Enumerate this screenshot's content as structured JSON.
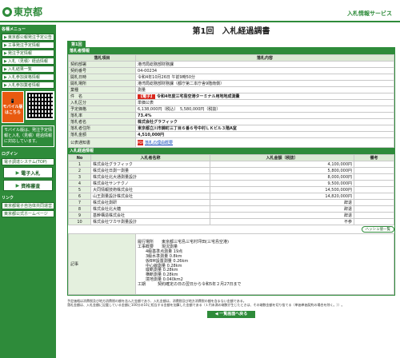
{
  "header": {
    "logo_text": "東京都",
    "service_title": "入札情報サービス"
  },
  "sidebar": {
    "menu_heading": "各種メニュー",
    "menu_items": [
      "東京都公報発注予定公告",
      "工事発注予定情報",
      "発注予定情報",
      "入札（見積）経過情報",
      "入札結果一覧",
      "入札参加資格情報",
      "入札参加業者情報"
    ],
    "mobile_label": "モバイル版はこちら",
    "mobile_note": "モバイル版は、発注予定情報と入札（見積）経過情報に対応しています。",
    "login_heading": "ログイン",
    "login_system_label": "電子調達システム(TOP)",
    "big_buttons": [
      "電子入札",
      "資格審査"
    ],
    "links_heading": "リンク",
    "links": [
      "東京都電子自治体共同運営",
      "東京都公式ホームページ"
    ]
  },
  "page": {
    "title": "第1回　入札経過調書",
    "round_label": "第1回",
    "info_section_title": "落札者情報",
    "info_col_item": "落札項目",
    "info_col_content": "落札内容",
    "info_rows": [
      {
        "label": "契約部署",
        "value": "港湾局総務部財務課"
      },
      {
        "label": "契約番号",
        "value": "04-00234"
      },
      {
        "label": "開札日時",
        "value": "令和4年10月26日 午前9時50分"
      },
      {
        "label": "開札場所",
        "value": "港湾局総務部財務課（都庁第二本庁舎9階南側）"
      },
      {
        "label": "業種",
        "value": "測量"
      },
      {
        "label": "件　名",
        "badge": "【電子】",
        "value": "令和4年度三宅島空港ターミナル用地地成測量"
      },
      {
        "label": "入札区分",
        "value": "単価公表"
      },
      {
        "label": "予定価格",
        "value": "6,138,000円（税込）　5,580,000円（税抜）"
      },
      {
        "label": "落札率",
        "value": "73.4%"
      },
      {
        "label": "落札者名",
        "value": "株式会社グラフィック"
      },
      {
        "label": "落札者住所",
        "value": "東京都立川市錦町三丁目６番６号中村ＬＫビル３階A室"
      },
      {
        "label": "落札金額",
        "value": "4,510,000円"
      },
      {
        "label": "公表通知書",
        "link": "落札の理由概要"
      }
    ],
    "bid_section_title": "入札経過情報",
    "bid_cols": [
      "No",
      "入札者名称",
      "入札金額（税抜）",
      "備考"
    ],
    "bids": [
      {
        "no": "1",
        "name": "株式会社グラフィック",
        "amount": "4,100,000円",
        "note": ""
      },
      {
        "no": "2",
        "name": "株式会社日測一測量",
        "amount": "5,800,000円",
        "note": ""
      },
      {
        "no": "3",
        "name": "株式会社北大通測量設計",
        "amount": "8,000,000円",
        "note": ""
      },
      {
        "no": "4",
        "name": "株式会社サンテクノ",
        "amount": "9,500,000円",
        "note": ""
      },
      {
        "no": "5",
        "name": "大同情報技術株式会社",
        "amount": "14,500,000円",
        "note": ""
      },
      {
        "no": "6",
        "name": "山王測量設計株式会社",
        "amount": "14,820,000円",
        "note": ""
      },
      {
        "no": "7",
        "name": "株式会社測研",
        "amount": "辞退",
        "note": ""
      },
      {
        "no": "8",
        "name": "株式会社北大糖",
        "amount": "辞退",
        "note": ""
      },
      {
        "no": "9",
        "name": "基幹構造株式会社",
        "amount": "辞退",
        "note": ""
      },
      {
        "no": "10",
        "name": "株式会社ワカサ測量設計",
        "amount": "不参",
        "note": ""
      }
    ],
    "hash_button": "ハッシュ値一覧",
    "memo_label": "記事",
    "memo_lines": [
      "履行場所　　東京都三宅島三宅村坪田(三宅島空港)",
      "工事概要　　現況測量",
      "　　4級基準点測量 19点",
      "　　3級水準測量 0.8km",
      "　　仮BM設置測量 0.26km",
      "　　中心線測量 0.28km",
      "　　縦断測量 0.28km",
      "　　横断測量 0.28km",
      "　　境地測量 0.040km2",
      "工期　　　契約確定の日の翌日から令和5年２月27日まで"
    ],
    "footnotes": [
      "予定価格は消費税及び地方消費税の額を含んだ金額であり、入札金額は、消費税及び地方消費税の額を含まない金額である。",
      "落札金額は、入札金額に記載している金額に100分の10に相当する金額を加算した金額である（１円未満の端数が生じたときは、その端数金額を切り捨てる（単価単価契約の場合を除く。））。"
    ],
    "back_button": "◀ 一覧画面へ戻る"
  },
  "colors": {
    "brand_green": "#2e8b3a",
    "alert_red": "#d9261c",
    "mobile_orange": "#e85a10"
  }
}
